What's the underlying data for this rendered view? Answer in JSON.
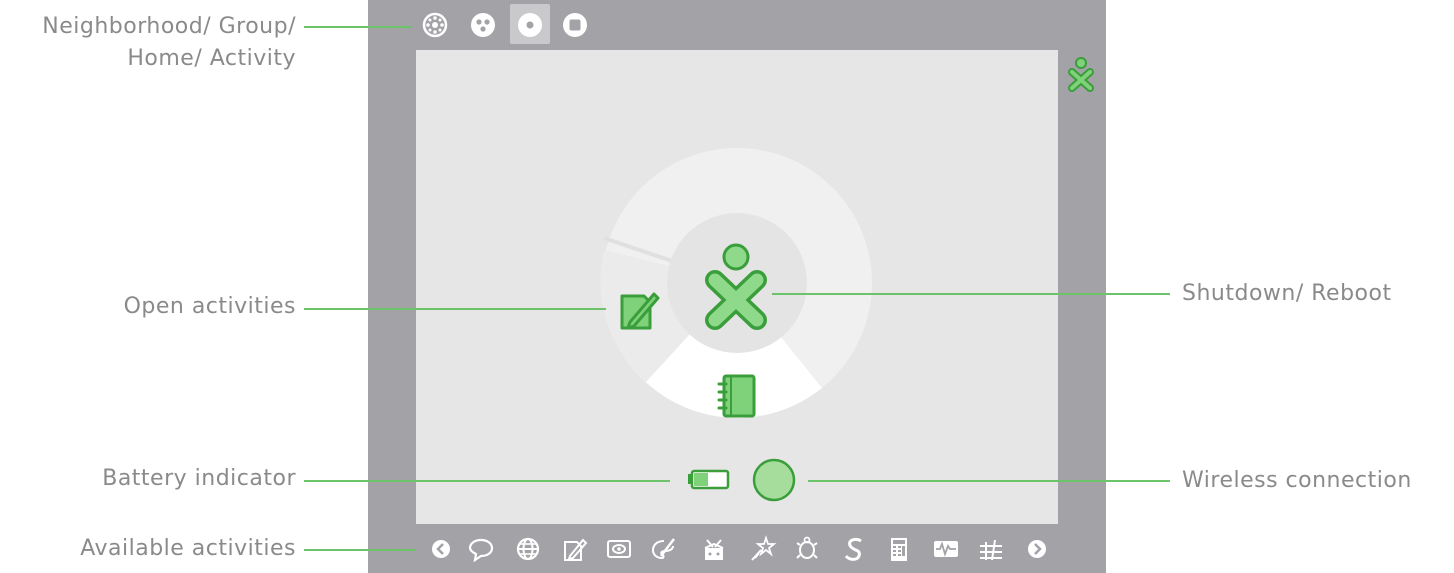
{
  "labels": {
    "neighborhood_line1": "Neighborhood/ Group/",
    "neighborhood_line2": "Home/ Activity",
    "open_activities": "Open activities",
    "battery_indicator": "Battery indicator",
    "available_activities": "Available activities",
    "shutdown_reboot": "Shutdown/ Reboot",
    "wireless_connection": "Wireless connection"
  },
  "top_zoom_icons": [
    "neighborhood-icon",
    "group-icon",
    "home-icon",
    "activity-icon"
  ],
  "selected_zoom": "home-icon",
  "bottom_activity_icons": [
    "scroll-left-icon",
    "chat-icon",
    "web-icon",
    "write-icon",
    "record-icon",
    "paint-icon",
    "tamtam-icon",
    "etoys-icon",
    "turtleart-icon",
    "pippy-icon",
    "calculate-icon",
    "measure-icon",
    "memorize-icon",
    "scroll-right-icon"
  ],
  "colors": {
    "frame": "#a3a2a7",
    "screen": "#e6e6e6",
    "accent": "#6dc36a",
    "accent_dark": "#3a9e3a",
    "label": "#8a8a8a"
  }
}
